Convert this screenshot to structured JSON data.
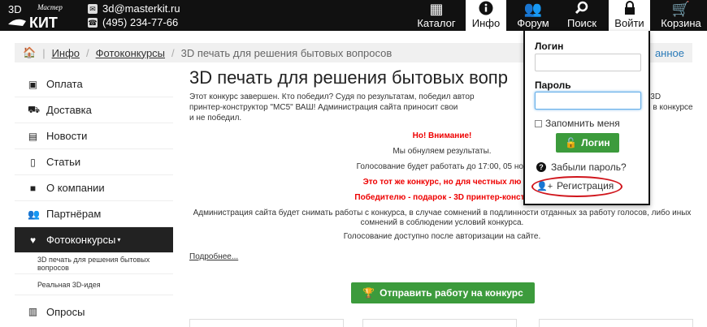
{
  "header": {
    "logo_text": "3D МАСТЕР КИТ",
    "email": "3d@masterkit.ru",
    "phone": "(495) 234-77-66",
    "nav": [
      {
        "label": "Каталог",
        "icon": "grid-icon"
      },
      {
        "label": "Инфо",
        "icon": "info-icon"
      },
      {
        "label": "Форум",
        "icon": "users-icon"
      },
      {
        "label": "Поиск",
        "icon": "search-icon"
      },
      {
        "label": "Войти",
        "icon": "lock-icon"
      },
      {
        "label": "Корзина",
        "icon": "cart-icon"
      }
    ]
  },
  "breadcrumb": {
    "items": [
      "Инфо",
      "Фотоконкурсы"
    ],
    "current": "3D печать для решения бытовых вопросов",
    "right_link": "анное"
  },
  "sidebar": {
    "items": [
      {
        "label": "Оплата",
        "icon": "money-icon"
      },
      {
        "label": "Доставка",
        "icon": "truck-icon"
      },
      {
        "label": "Новости",
        "icon": "newspaper-icon"
      },
      {
        "label": "Статьи",
        "icon": "document-icon"
      },
      {
        "label": "О компании",
        "icon": "briefcase-icon"
      },
      {
        "label": "Партнёрам",
        "icon": "users-icon"
      },
      {
        "label": "Фотоконкурсы",
        "icon": "heart-icon"
      }
    ],
    "subitems": [
      "3D печать для решения бытовых вопросов",
      "Реальная 3D-идея"
    ],
    "after": {
      "label": "Опросы",
      "icon": "bar-chart-icon"
    }
  },
  "main": {
    "title": "3D печать для решения бытовых вопр",
    "lead": "Этот конкурс завершен. Кто победил? Судя по результатам, победил автор                                                          здравляем! 3D принтер-конструктор \"MC5\" ВАШ! Администрация сайта приносит свои                                                          стно участвовал в конкурсе и не победил.",
    "attention": "Но! Внимание!",
    "reset": "Мы обнуляем результаты.",
    "voting_until": "Голосование будет работать до 17:00, 05 ноя",
    "same_contest": "Это тот же конкурс, но для честных лю",
    "prize": "Победителю - подарок - 3D принтер-констр",
    "admin_note": "Администрация сайта будет снимать работы с конкурса, в случае сомнений в подлинности отданных за работу голосов, либо иных сомнений в соблюдении условий конкурса.",
    "auth_note": "Голосование доступно после авторизации на сайте.",
    "more": "Подробнее...",
    "send_button": "Отправить работу на конкурс"
  },
  "login_dropdown": {
    "login_label": "Логин",
    "login_value": "",
    "password_label": "Пароль",
    "password_value": "",
    "remember": "Запомнить меня",
    "submit": "Логин",
    "forgot": "Забыли пароль?",
    "register": "Регистрация",
    "highlight_color": "#d0141b"
  },
  "colors": {
    "header_bg": "#111111",
    "accent_green": "#3c9b3c",
    "alert_red": "#ee0000",
    "link_blue": "#2a7ab8"
  }
}
